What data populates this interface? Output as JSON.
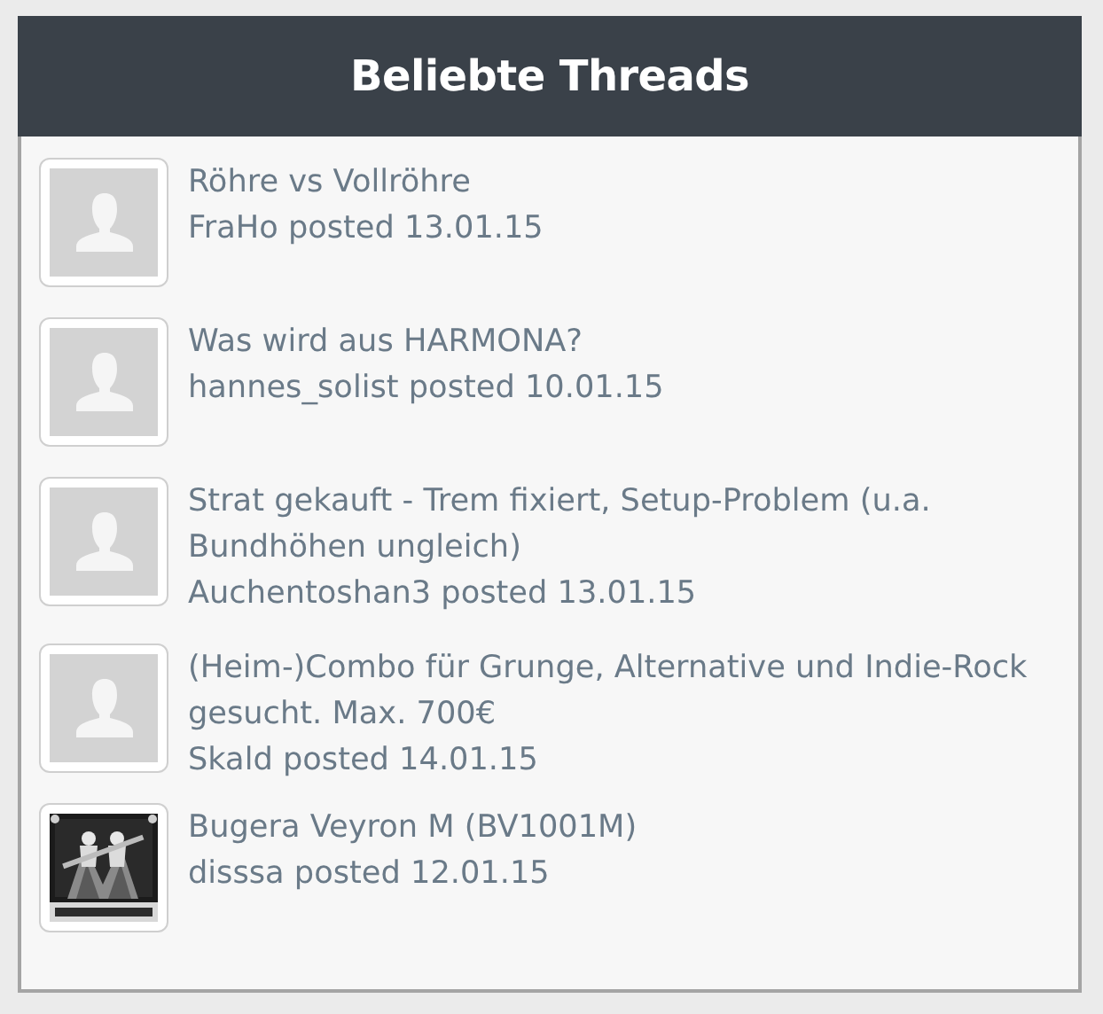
{
  "header": {
    "title": "Beliebte Threads"
  },
  "threads": [
    {
      "title": "Röhre vs Vollröhre",
      "meta": "FraHo posted 13.01.15",
      "avatar": {
        "kind": "default"
      }
    },
    {
      "title": "Was wird aus HARMONA?",
      "meta": "hannes_solist posted 10.01.15",
      "avatar": {
        "kind": "default"
      }
    },
    {
      "title": "Strat gekauft - Trem fixiert, Setup-Problem (u.a. Bundhöhen ungleich)",
      "meta": "Auchentoshan3 posted 13.01.15",
      "avatar": {
        "kind": "default"
      }
    },
    {
      "title": "(Heim-)Combo für Grunge, Alternative und Indie-Rock gesucht. Max. 700€",
      "meta": "Skald posted 14.01.15",
      "avatar": {
        "kind": "default"
      }
    },
    {
      "title": "Bugera Veyron M (BV1001M)",
      "meta": "disssa posted 12.01.15"
    }
  ]
}
